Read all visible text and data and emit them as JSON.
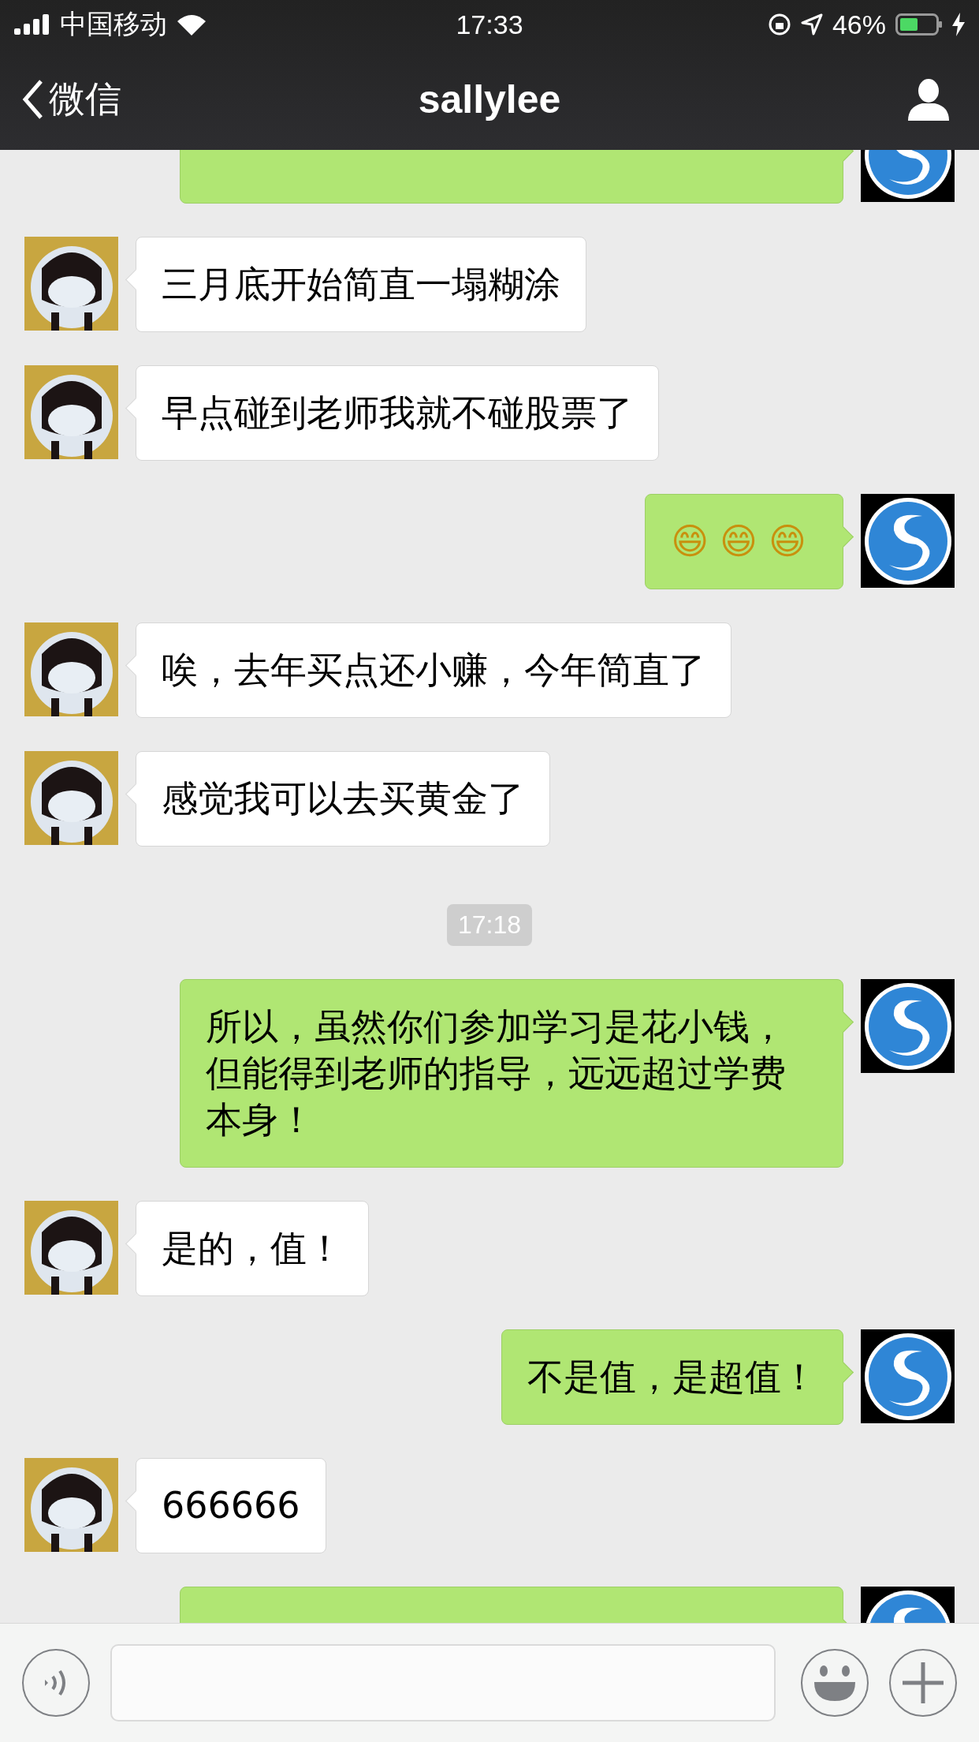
{
  "status_bar": {
    "carrier": "中国移动",
    "time": "17:33",
    "battery": "46%"
  },
  "nav": {
    "back": "微信",
    "title": "sallylee"
  },
  "messages": [
    {
      "kind": "sent"
    },
    {
      "kind": "received",
      "text": "三月底开始简直一塌糊涂"
    },
    {
      "kind": "received",
      "text": "早点碰到老师我就不碰股票了"
    },
    {
      "kind": "sent",
      "text": "😄😄😄"
    },
    {
      "kind": "received",
      "text": "唉，去年买点还小赚，今年简直了"
    },
    {
      "kind": "received",
      "text": "感觉我可以去买黄金了"
    },
    {
      "kind": "timestamp",
      "text": "17:18"
    },
    {
      "kind": "sent",
      "text": "所以，虽然你们参加学习是花小钱，但能得到老师的指导，远远超过学费本身！"
    },
    {
      "kind": "received",
      "text": "是的，值！"
    },
    {
      "kind": "sent",
      "text": "不是值，是超值！"
    },
    {
      "kind": "received",
      "text": "666666"
    },
    {
      "kind": "sent"
    }
  ]
}
